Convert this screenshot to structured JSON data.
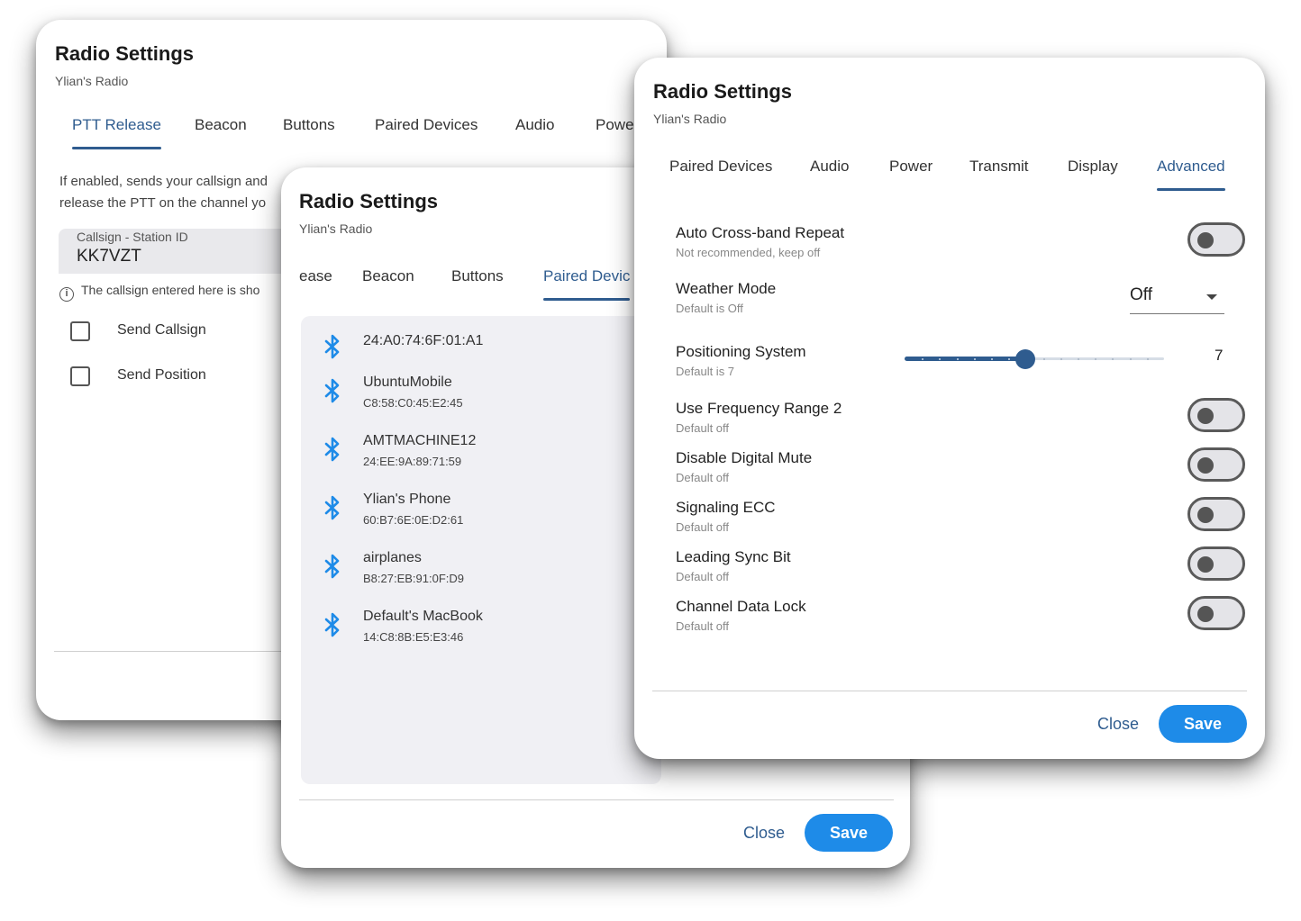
{
  "dialog_ptt": {
    "title": "Radio Settings",
    "subtitle": "Ylian's Radio",
    "tabs": [
      "PTT Release",
      "Beacon",
      "Buttons",
      "Paired Devices",
      "Audio",
      "Powe"
    ],
    "active_tab": "PTT Release",
    "description_line1": "If enabled, sends your callsign and",
    "description_line2": "release the PTT on the channel yo",
    "callsign_label": "Callsign - Station ID",
    "callsign_value": "KK7VZT",
    "helper_text": "The callsign entered here is sho",
    "info_icon": "info-icon",
    "checkboxes": [
      {
        "label": "Send Callsign",
        "checked": false
      },
      {
        "label": "Send Position",
        "checked": false
      }
    ]
  },
  "dialog_devices": {
    "title": "Radio Settings",
    "subtitle": "Ylian's Radio",
    "tabs": [
      "ease",
      "Beacon",
      "Buttons",
      "Paired Devic"
    ],
    "active_tab": "Paired Devic",
    "device_icon": "bluetooth-icon",
    "devices": [
      {
        "name": "24:A0:74:6F:01:A1",
        "mac": ""
      },
      {
        "name": "UbuntuMobile",
        "mac": "C8:58:C0:45:E2:45"
      },
      {
        "name": "AMTMACHINE12",
        "mac": "24:EE:9A:89:71:59"
      },
      {
        "name": "Ylian's Phone",
        "mac": "60:B7:6E:0E:D2:61"
      },
      {
        "name": "airplanes",
        "mac": "B8:27:EB:91:0F:D9"
      },
      {
        "name": "Default's MacBook",
        "mac": "14:C8:8B:E5:E3:46"
      }
    ],
    "close_label": "Close",
    "save_label": "Save"
  },
  "dialog_advanced": {
    "title": "Radio Settings",
    "subtitle": "Ylian's Radio",
    "tabs": [
      "Paired Devices",
      "Audio",
      "Power",
      "Transmit",
      "Display",
      "Advanced"
    ],
    "active_tab": "Advanced",
    "settings": [
      {
        "title": "Auto Cross-band Repeat",
        "sub": "Not recommended, keep off",
        "control": "toggle",
        "on": false
      },
      {
        "title": "Weather Mode",
        "sub": "Default is Off",
        "control": "select",
        "value": "Off"
      },
      {
        "title": "Positioning System",
        "sub": "Default is 7",
        "control": "slider",
        "value": 7,
        "min": 0,
        "max": 15
      },
      {
        "title": "Use Frequency Range 2",
        "sub": "Default off",
        "control": "toggle",
        "on": false
      },
      {
        "title": "Disable Digital Mute",
        "sub": "Default off",
        "control": "toggle",
        "on": false
      },
      {
        "title": "Signaling ECC",
        "sub": "Default off",
        "control": "toggle",
        "on": false
      },
      {
        "title": "Leading Sync Bit",
        "sub": "Default off",
        "control": "toggle",
        "on": false
      },
      {
        "title": "Channel Data Lock",
        "sub": "Default off",
        "control": "toggle",
        "on": false
      }
    ],
    "close_label": "Close",
    "save_label": "Save"
  },
  "colors": {
    "accent": "#2f5c8f",
    "save_button": "#1e8be8",
    "bluetooth_icon": "#1e8be8",
    "toggle_off_track": "#e4e4e8",
    "panel_bg": "#f0f0f4"
  }
}
